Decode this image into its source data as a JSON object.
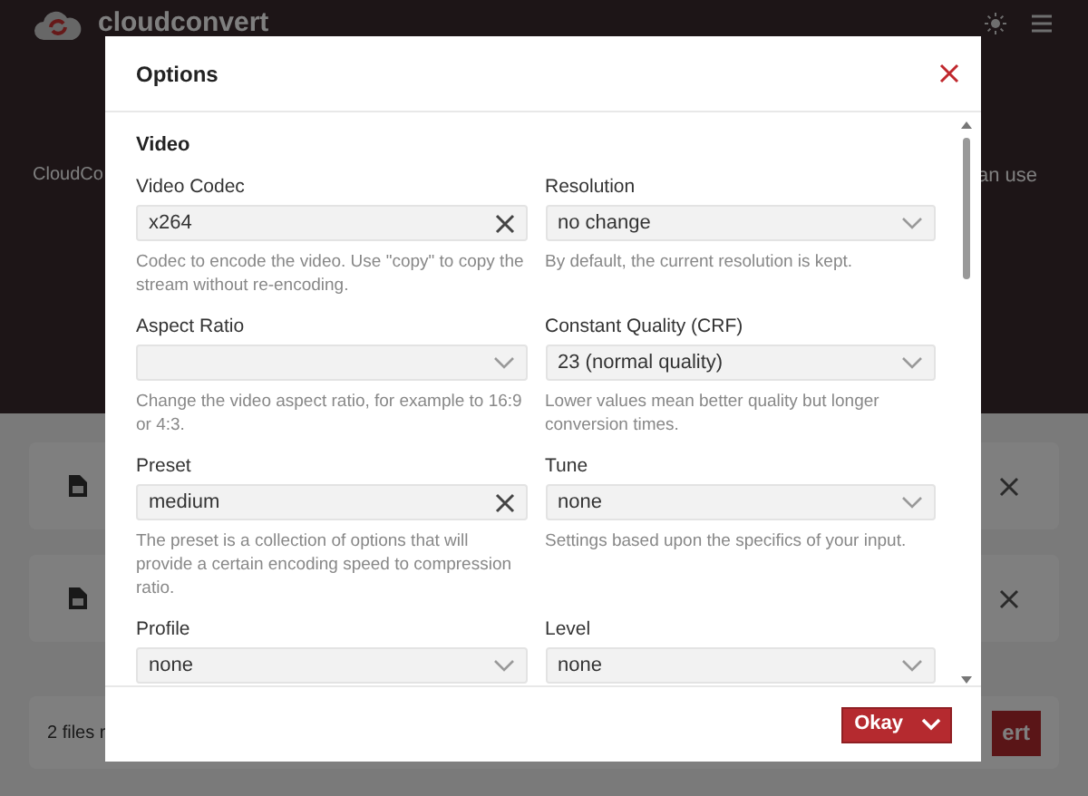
{
  "header": {
    "logo_text": "cloudconvert",
    "intro_left": "CloudCo",
    "intro_right": "an use"
  },
  "files": [
    {
      "kind": "file"
    },
    {
      "kind": "file"
    }
  ],
  "footer": {
    "status": "2 files r",
    "button": "ert"
  },
  "dialog": {
    "title": "Options",
    "section": "Video",
    "fields": [
      {
        "label": "Video Codec",
        "value": "x264",
        "kind": "clear",
        "help": "Codec to encode the video. Use \"copy\" to copy the stream without re-encoding."
      },
      {
        "label": "Resolution",
        "value": "no change",
        "kind": "select",
        "help": "By default, the current resolution is kept."
      },
      {
        "label": "Aspect Ratio",
        "kind": "select",
        "help": "Change the video aspect ratio, for example to 16:9 or 4:3."
      },
      {
        "label": "Constant Quality (CRF)",
        "value": "23 (normal quality)",
        "kind": "select",
        "help": "Lower values mean better quality but longer conversion times."
      },
      {
        "label": "Preset",
        "value": "medium",
        "kind": "clear",
        "help": "The preset is a collection of options that will provide a certain encoding speed to compression ratio."
      },
      {
        "label": "Tune",
        "value": "none",
        "kind": "select",
        "help": "Settings based upon the specifics of your input."
      },
      {
        "label": "Profile",
        "value": "none",
        "kind": "select"
      },
      {
        "label": "Level",
        "value": "none",
        "kind": "select"
      }
    ],
    "ok_button": "Okay"
  }
}
